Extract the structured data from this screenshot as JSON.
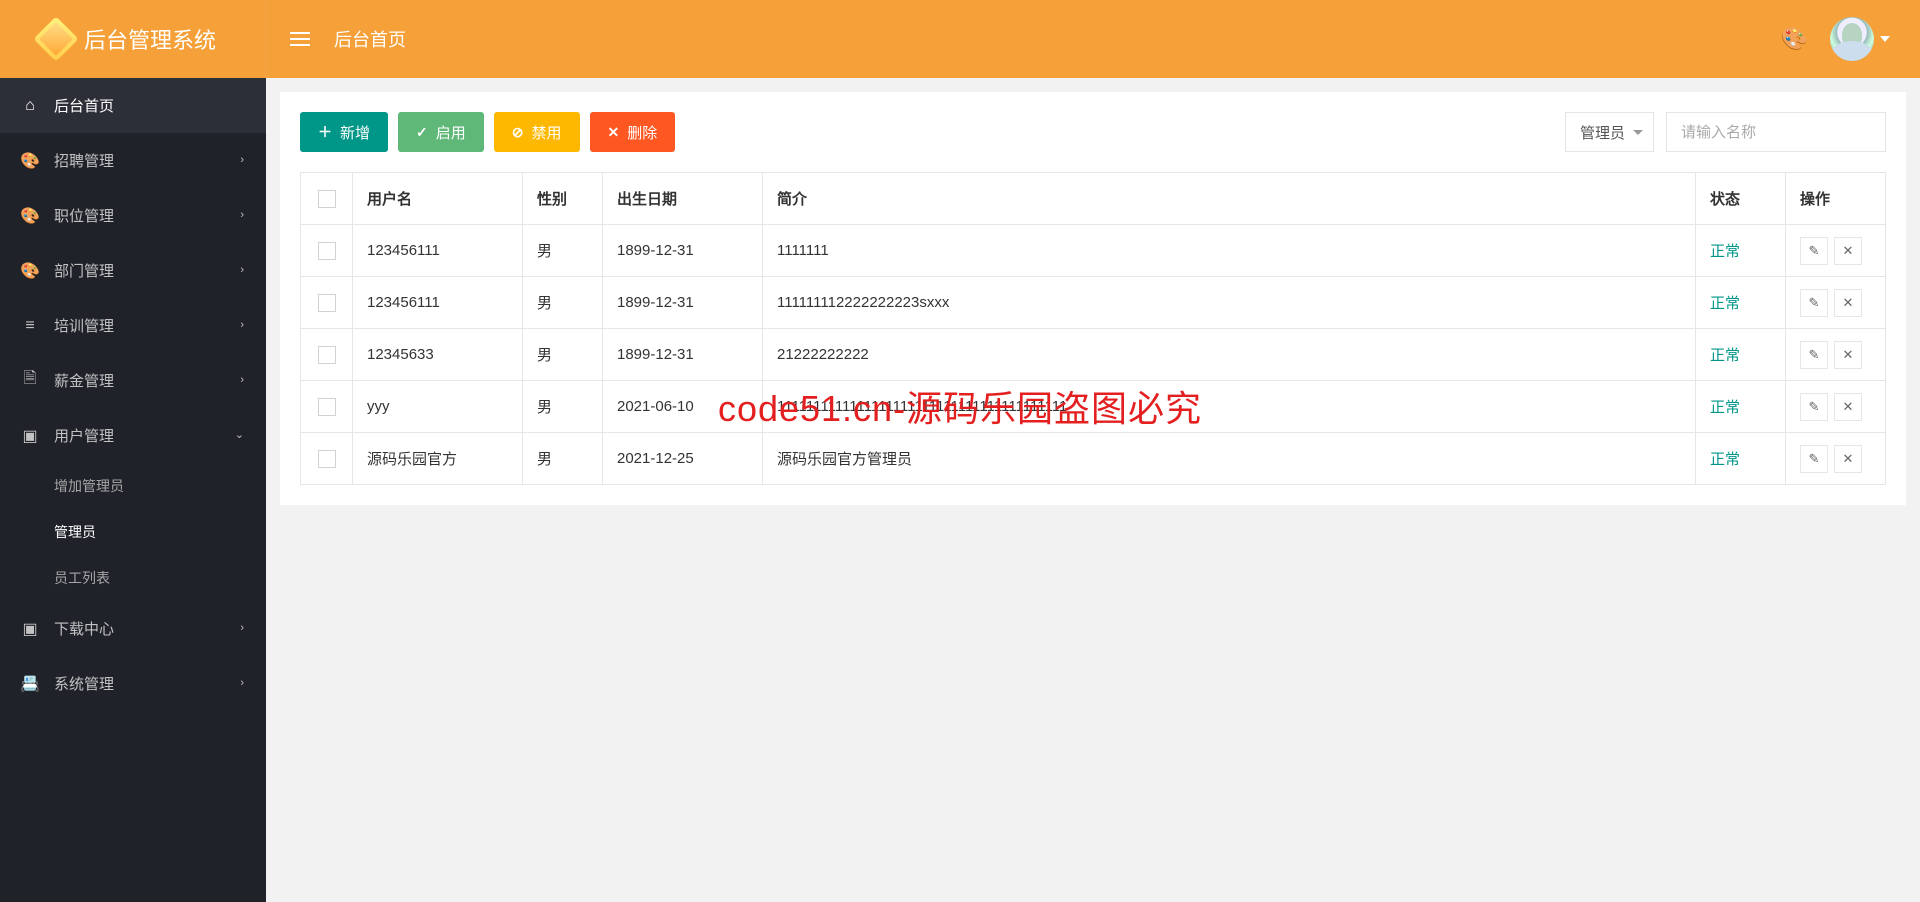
{
  "header": {
    "app_title": "后台管理系统",
    "breadcrumb": "后台首页"
  },
  "sidebar": {
    "items": [
      {
        "icon": "home",
        "label": "后台首页",
        "arrow": false
      },
      {
        "icon": "palette",
        "label": "招聘管理",
        "arrow": true
      },
      {
        "icon": "palette",
        "label": "职位管理",
        "arrow": true
      },
      {
        "icon": "palette",
        "label": "部门管理",
        "arrow": true
      },
      {
        "icon": "list",
        "label": "培训管理",
        "arrow": true
      },
      {
        "icon": "file",
        "label": "薪金管理",
        "arrow": true
      },
      {
        "icon": "js",
        "label": "用户管理",
        "arrow": true,
        "open": true,
        "subs": [
          {
            "label": "增加管理员"
          },
          {
            "label": "管理员",
            "active": true
          },
          {
            "label": "员工列表"
          }
        ]
      },
      {
        "icon": "js",
        "label": "下载中心",
        "arrow": true
      },
      {
        "icon": "calendar",
        "label": "系统管理",
        "arrow": true
      }
    ]
  },
  "toolbar": {
    "add": "新增",
    "enable": "启用",
    "disable": "禁用",
    "delete": "删除",
    "role_select": "管理员",
    "search_placeholder": "请输入名称"
  },
  "table": {
    "headers": {
      "username": "用户名",
      "gender": "性别",
      "birth": "出生日期",
      "intro": "简介",
      "status": "状态",
      "action": "操作"
    },
    "rows": [
      {
        "username": "123456111",
        "gender": "男",
        "birth": "1899-12-31",
        "intro": "1111111",
        "status": "正常"
      },
      {
        "username": "123456111",
        "gender": "男",
        "birth": "1899-12-31",
        "intro": "111111112222222223sxxx",
        "status": "正常"
      },
      {
        "username": "12345633",
        "gender": "男",
        "birth": "1899-12-31",
        "intro": "21222222222",
        "status": "正常"
      },
      {
        "username": "yyy",
        "gender": "男",
        "birth": "2021-06-10",
        "intro": "1111111111111111111111111111111111111111",
        "status": "正常"
      },
      {
        "username": "源码乐园官方",
        "gender": "男",
        "birth": "2021-12-25",
        "intro": "源码乐园官方管理员",
        "status": "正常"
      }
    ]
  },
  "watermark": "code51.cn-源码乐园盗图必究"
}
